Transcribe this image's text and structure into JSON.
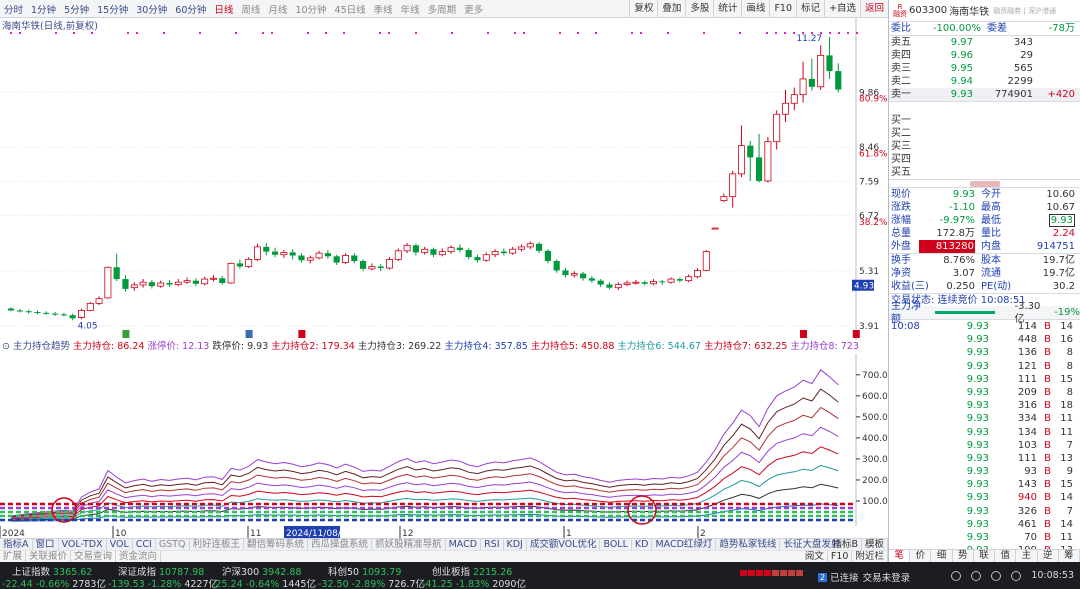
{
  "periods": [
    "分时",
    "1分钟",
    "5分钟",
    "15分钟",
    "30分钟",
    "60分钟",
    "日线",
    "周线",
    "月线",
    "10分钟",
    "45日线",
    "季线",
    "年线",
    "多周期",
    "更多"
  ],
  "active_period": "日线",
  "top_right": [
    "复权",
    "叠加",
    "多股",
    "统计",
    "画线",
    "F10",
    "标记",
    "+自选",
    "返回"
  ],
  "main_title": "海南华铁(日线,前复权)",
  "price_axis": {
    "labels": [
      "9.86",
      "80.9%",
      "8.46",
      "61.8%",
      "7.59",
      "6.72",
      "38.2%",
      "5.31",
      "4.93",
      "3.91"
    ]
  },
  "annotations": {
    "high": "11.27",
    "low": "4.05"
  },
  "chart_data": {
    "type": "candlestick",
    "title": "海南华铁(日线,前复权)",
    "ylim": [
      3.7,
      11.6
    ],
    "date_labels": [
      "2024",
      "10",
      "11",
      "2024/11/08/五",
      "12",
      "1",
      "2"
    ],
    "candles": [
      [
        4.35,
        4.3,
        4.38,
        4.28
      ],
      [
        4.3,
        4.28,
        4.34,
        4.25
      ],
      [
        4.28,
        4.26,
        4.32,
        4.22
      ],
      [
        4.26,
        4.24,
        4.3,
        4.2
      ],
      [
        4.24,
        4.22,
        4.28,
        4.19
      ],
      [
        4.22,
        4.2,
        4.26,
        4.16
      ],
      [
        4.2,
        4.18,
        4.24,
        4.15
      ],
      [
        4.18,
        4.1,
        4.22,
        4.05
      ],
      [
        4.12,
        4.3,
        4.35,
        4.08
      ],
      [
        4.3,
        4.48,
        4.52,
        4.28
      ],
      [
        4.48,
        4.6,
        4.66,
        4.44
      ],
      [
        4.62,
        5.4,
        5.42,
        4.6
      ],
      [
        5.4,
        5.1,
        5.75,
        5.05
      ],
      [
        5.1,
        4.85,
        5.2,
        4.78
      ],
      [
        4.88,
        4.95,
        5.02,
        4.8
      ],
      [
        4.95,
        5.02,
        5.1,
        4.88
      ],
      [
        5.02,
        4.92,
        5.08,
        4.86
      ],
      [
        4.92,
        5.0,
        5.06,
        4.88
      ],
      [
        5.0,
        4.96,
        5.08,
        4.9
      ],
      [
        4.96,
        5.02,
        5.1,
        4.92
      ],
      [
        5.02,
        5.06,
        5.14,
        4.98
      ],
      [
        5.06,
        4.98,
        5.12,
        4.92
      ],
      [
        4.98,
        5.1,
        5.16,
        4.94
      ],
      [
        5.1,
        5.12,
        5.2,
        5.04
      ],
      [
        5.12,
        5.0,
        5.18,
        4.96
      ],
      [
        5.0,
        5.5,
        5.52,
        4.98
      ],
      [
        5.5,
        5.42,
        5.6,
        5.36
      ],
      [
        5.42,
        5.6,
        5.66,
        5.38
      ],
      [
        5.6,
        5.92,
        6.0,
        5.56
      ],
      [
        5.92,
        5.8,
        6.02,
        5.7
      ],
      [
        5.8,
        5.72,
        5.9,
        5.66
      ],
      [
        5.72,
        5.78,
        5.84,
        5.64
      ],
      [
        5.78,
        5.7,
        5.86,
        5.6
      ],
      [
        5.7,
        5.58,
        5.76,
        5.52
      ],
      [
        5.58,
        5.64,
        5.7,
        5.5
      ],
      [
        5.64,
        5.76,
        5.82,
        5.6
      ],
      [
        5.76,
        5.68,
        5.84,
        5.62
      ],
      [
        5.68,
        5.52,
        5.72,
        5.46
      ],
      [
        5.52,
        5.7,
        5.76,
        5.48
      ],
      [
        5.7,
        5.56,
        5.76,
        5.5
      ],
      [
        5.56,
        5.36,
        5.6,
        5.3
      ],
      [
        5.36,
        5.42,
        5.5,
        5.32
      ],
      [
        5.42,
        5.38,
        5.48,
        5.3
      ],
      [
        5.38,
        5.6,
        5.66,
        5.34
      ],
      [
        5.6,
        5.82,
        5.88,
        5.56
      ],
      [
        5.82,
        5.96,
        6.02,
        5.76
      ],
      [
        5.96,
        5.78,
        6.0,
        5.7
      ],
      [
        5.78,
        5.86,
        5.92,
        5.72
      ],
      [
        5.86,
        5.72,
        5.9,
        5.66
      ],
      [
        5.72,
        5.8,
        5.88,
        5.68
      ],
      [
        5.8,
        5.9,
        5.96,
        5.74
      ],
      [
        5.9,
        5.84,
        5.98,
        5.78
      ],
      [
        5.84,
        5.66,
        5.88,
        5.6
      ],
      [
        5.66,
        5.58,
        5.72,
        5.52
      ],
      [
        5.58,
        5.72,
        5.78,
        5.54
      ],
      [
        5.72,
        5.8,
        5.86,
        5.66
      ],
      [
        5.8,
        5.76,
        5.88,
        5.7
      ],
      [
        5.76,
        5.86,
        5.92,
        5.72
      ],
      [
        5.86,
        5.92,
        5.98,
        5.8
      ],
      [
        5.92,
        6.0,
        6.06,
        5.86
      ],
      [
        6.0,
        5.82,
        6.04,
        5.76
      ],
      [
        5.82,
        5.56,
        5.86,
        5.5
      ],
      [
        5.56,
        5.32,
        5.6,
        5.26
      ],
      [
        5.32,
        5.2,
        5.38,
        5.14
      ],
      [
        5.2,
        5.24,
        5.3,
        5.14
      ],
      [
        5.24,
        5.12,
        5.28,
        5.06
      ],
      [
        5.12,
        5.06,
        5.18,
        5.0
      ],
      [
        5.06,
        4.96,
        5.1,
        4.9
      ],
      [
        4.96,
        4.88,
        5.02,
        4.84
      ],
      [
        4.88,
        4.96,
        5.02,
        4.82
      ],
      [
        4.96,
        5.0,
        5.06,
        4.92
      ],
      [
        5.0,
        5.02,
        5.08,
        4.96
      ],
      [
        5.02,
        4.98,
        5.06,
        4.94
      ],
      [
        4.98,
        5.04,
        5.1,
        4.94
      ],
      [
        5.04,
        5.02,
        5.08,
        4.96
      ],
      [
        5.02,
        5.1,
        5.14,
        4.98
      ],
      [
        5.1,
        5.06,
        5.14,
        5.02
      ],
      [
        5.06,
        5.16,
        5.22,
        5.02
      ],
      [
        5.16,
        5.32,
        5.38,
        5.12
      ],
      [
        5.32,
        5.8,
        5.84,
        5.3
      ],
      [
        6.4,
        6.4,
        6.4,
        6.4
      ],
      [
        7.1,
        7.2,
        7.28,
        7.06
      ],
      [
        7.2,
        7.78,
        7.86,
        6.92
      ],
      [
        7.78,
        8.5,
        9.02,
        7.7
      ],
      [
        8.5,
        8.2,
        8.62,
        7.6
      ],
      [
        8.2,
        7.6,
        8.8,
        7.56
      ],
      [
        7.6,
        8.6,
        8.72,
        7.56
      ],
      [
        8.6,
        9.3,
        9.4,
        8.4
      ],
      [
        9.3,
        9.58,
        9.92,
        9.1
      ],
      [
        9.58,
        9.8,
        9.98,
        9.4
      ],
      [
        9.8,
        10.2,
        10.64,
        9.6
      ],
      [
        10.2,
        10.0,
        10.72,
        9.9
      ],
      [
        10.0,
        10.8,
        11.06,
        9.92
      ],
      [
        10.8,
        10.4,
        11.27,
        10.2
      ],
      [
        10.4,
        9.93,
        10.6,
        9.86
      ]
    ]
  },
  "indicator": {
    "name": "主力持仓趋势",
    "labels": [
      {
        "k": "主力持仓:",
        "v": "86.24"
      },
      {
        "k": "涨停价:",
        "v": "12.13"
      },
      {
        "k": "跌停价:",
        "v": "9.93"
      },
      {
        "k": "主力持仓2:",
        "v": "179.34"
      },
      {
        "k": "主力持仓3:",
        "v": "269.22"
      },
      {
        "k": "主力持仓4:",
        "v": "357.85"
      },
      {
        "k": "主力持仓5:",
        "v": "450.88"
      },
      {
        "k": "主力持仓6:",
        "v": "544.67"
      },
      {
        "k": "主力持仓7:",
        "v": "632.25"
      },
      {
        "k": "主力持仓8:",
        "v": "723.27"
      }
    ],
    "axis": [
      "700.0",
      "600.0",
      "500.0",
      "400.0",
      "300.0",
      "200.0",
      "100.0"
    ],
    "ylim": [
      0,
      780
    ]
  },
  "tabs1": [
    "指标A",
    "窗口",
    "VOL-TDX",
    "VOL",
    "CCI",
    "GSTQ",
    "利好连板王",
    "翻倍筹码系统",
    "西瓜操盘系统",
    "抓妖股精准导航",
    "MACD",
    "RSI",
    "KDJ",
    "成交额VOL优化",
    "BOLL",
    "KD",
    "MACD红绿灯",
    "趋势私家钱线",
    "长征大盘发射"
  ],
  "tabs1_right": [
    "指标B",
    "模板"
  ],
  "tabs2": [
    "扩展",
    "关联报价",
    "交易查询",
    "资金流向"
  ],
  "tabs2_right": [
    "阅文",
    "F10",
    "附近栏"
  ],
  "quote": {
    "code": "603300",
    "name": "海南华铁",
    "sub": "融资融券 | 深沪港通",
    "wb": {
      "k": "委比",
      "v": "-100.00%",
      "k2": "委差",
      "v2": "-78万"
    },
    "asks": [
      {
        "n": "卖五",
        "p": "9.97",
        "v": "343",
        "c": ""
      },
      {
        "n": "卖四",
        "p": "9.96",
        "v": "29",
        "c": ""
      },
      {
        "n": "卖三",
        "p": "9.95",
        "v": "565",
        "c": ""
      },
      {
        "n": "卖二",
        "p": "9.94",
        "v": "2299",
        "c": ""
      },
      {
        "n": "卖一",
        "p": "9.93",
        "v": "774901",
        "c": "+420"
      }
    ],
    "bids": [
      "买一",
      "买二",
      "买三",
      "买四",
      "买五"
    ],
    "stats": [
      {
        "k": "现价",
        "v": "9.93",
        "k2": "今开",
        "v2": "10.60"
      },
      {
        "k": "涨跌",
        "v": "-1.10",
        "k2": "最高",
        "v2": "10.67"
      },
      {
        "k": "涨幅",
        "v": "-9.97%",
        "k2": "最低",
        "v2": "9.93"
      },
      {
        "k": "总量",
        "v": "172.8万",
        "k2": "量比",
        "v2": "2.24"
      },
      {
        "k": "外盘",
        "v": "813280",
        "k2": "内盘",
        "v2": "914751"
      }
    ],
    "stats2": [
      {
        "k": "换手",
        "v": "8.76%",
        "k2": "股本",
        "v2": "19.7亿"
      },
      {
        "k": "净资",
        "v": "3.07",
        "k2": "流通",
        "v2": "19.7亿"
      },
      {
        "k": "收益(三)",
        "v": "0.250",
        "k2": "PE(动)",
        "v2": "30.2"
      }
    ],
    "status": "交易状态: 连续竞价 10:08:51",
    "netflow": {
      "k": "主力净额",
      "v": "-3.30亿",
      "p": "-19%"
    },
    "ticks_time": "10:08",
    "ticks": [
      {
        "p": "9.93",
        "v": "114",
        "d": "B",
        "n": "14"
      },
      {
        "p": "9.93",
        "v": "448",
        "d": "B",
        "n": "16"
      },
      {
        "p": "9.93",
        "v": "136",
        "d": "B",
        "n": "8"
      },
      {
        "p": "9.93",
        "v": "121",
        "d": "B",
        "n": "8"
      },
      {
        "p": "9.93",
        "v": "111",
        "d": "B",
        "n": "15"
      },
      {
        "p": "9.93",
        "v": "209",
        "d": "B",
        "n": "8"
      },
      {
        "p": "9.93",
        "v": "316",
        "d": "B",
        "n": "18"
      },
      {
        "p": "9.93",
        "v": "334",
        "d": "B",
        "n": "11"
      },
      {
        "p": "9.93",
        "v": "134",
        "d": "B",
        "n": "11"
      },
      {
        "p": "9.93",
        "v": "103",
        "d": "B",
        "n": "7"
      },
      {
        "p": "9.93",
        "v": "111",
        "d": "B",
        "n": "13"
      },
      {
        "p": "9.93",
        "v": "93",
        "d": "B",
        "n": "9"
      },
      {
        "p": "9.93",
        "v": "143",
        "d": "B",
        "n": "15"
      },
      {
        "p": "9.93",
        "v": "940",
        "d": "B",
        "n": "14"
      },
      {
        "p": "9.93",
        "v": "326",
        "d": "B",
        "n": "7"
      },
      {
        "p": "9.93",
        "v": "461",
        "d": "B",
        "n": "14"
      },
      {
        "p": "9.93",
        "v": "70",
        "d": "B",
        "n": "11"
      },
      {
        "p": "9.93",
        "v": "199",
        "d": "B",
        "n": "13"
      }
    ],
    "bottom_tabs": [
      "笔",
      "价",
      "细",
      "势",
      "联",
      "值",
      "主",
      "逆",
      "筹"
    ]
  },
  "status_bar": {
    "indices": [
      {
        "name": "上证指数",
        "val": "3365.62",
        "chg": "-22.44",
        "pct": "-0.66%",
        "amt": "2783亿"
      },
      {
        "name": "深证成指",
        "val": "10787.98",
        "chg": "-139.53",
        "pct": "-1.28%",
        "amt": "4227亿"
      },
      {
        "name": "沪深300",
        "val": "3942.88",
        "chg": "-25.24",
        "pct": "-0.64%",
        "amt": "1445亿"
      },
      {
        "name": "科创50",
        "val": "1093.79",
        "chg": "-32.50",
        "pct": "-2.89%",
        "amt": "726.7亿"
      },
      {
        "name": "创业板指",
        "val": "2215.26",
        "chg": "-41.25",
        "pct": "-1.83%",
        "amt": "2090亿"
      }
    ],
    "connected": "已连接",
    "trade": "交易未登录",
    "time": "10:08:53"
  },
  "colors": {
    "up": "#d0021b",
    "down": "#009a3e",
    "dots": "#e020c0"
  }
}
